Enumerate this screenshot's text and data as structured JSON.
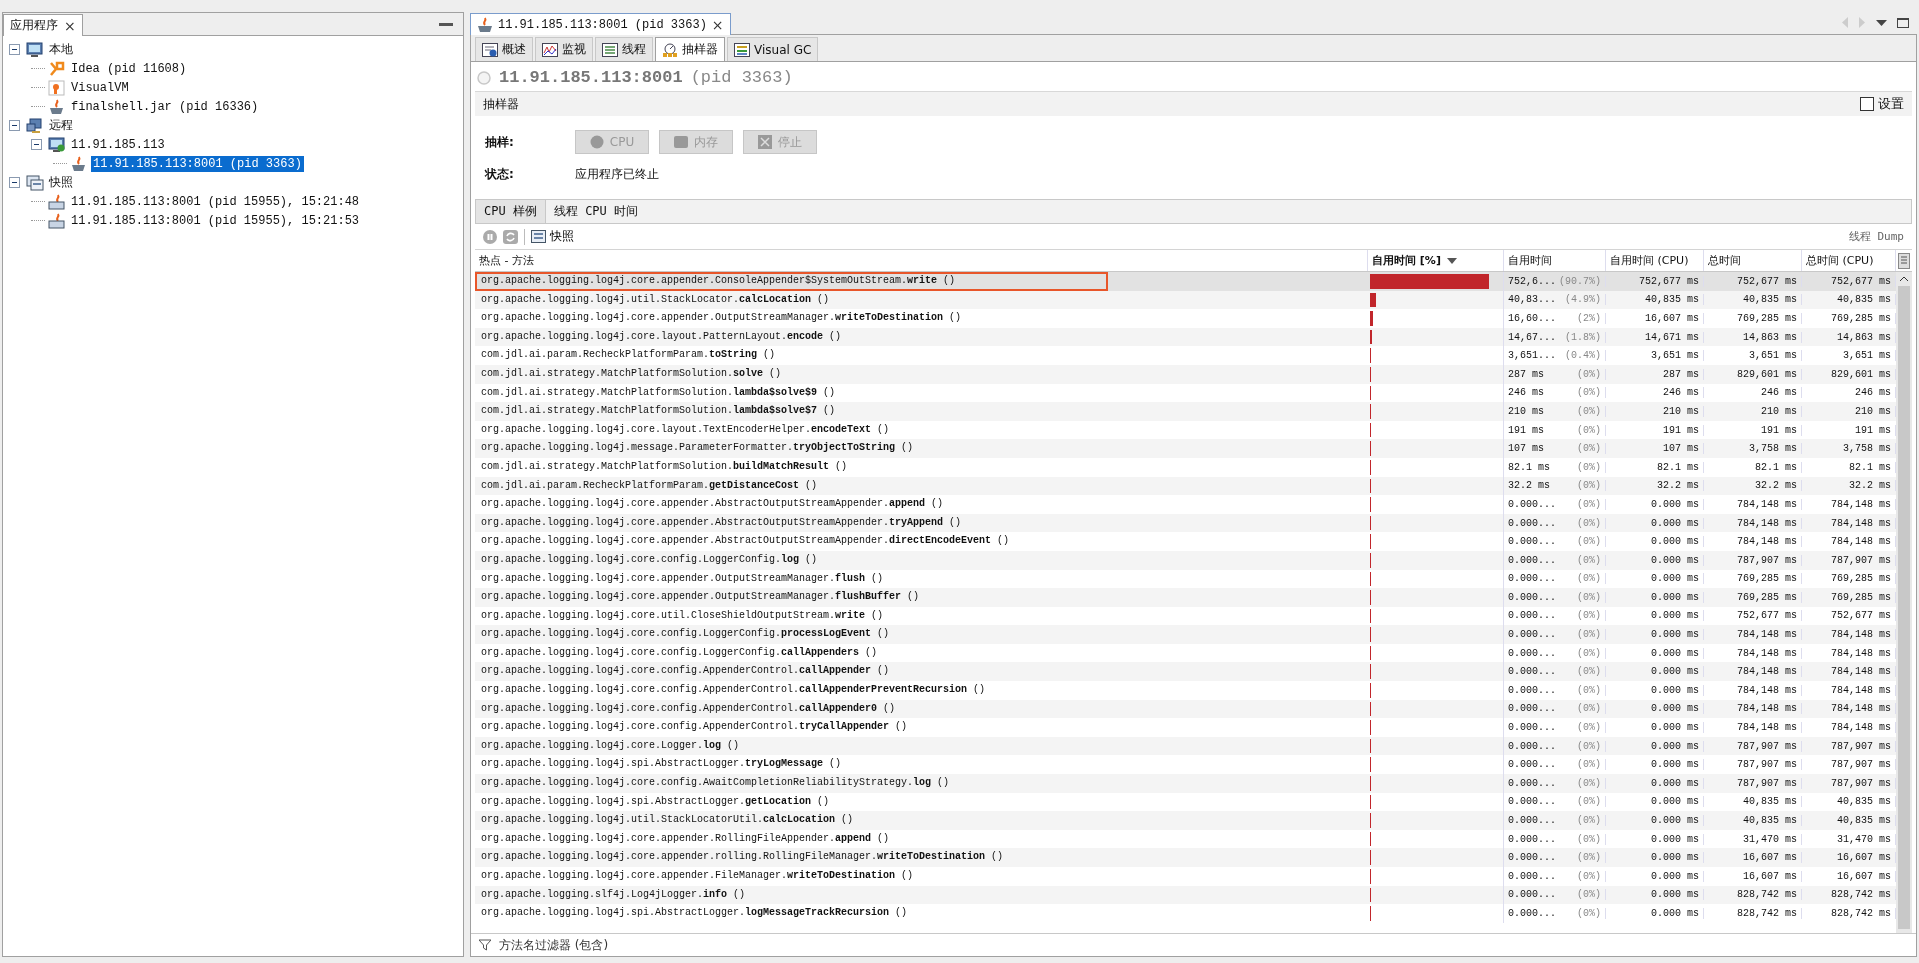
{
  "left_panel": {
    "tab": "应用程序",
    "close": "×",
    "tree": [
      {
        "label": "本地",
        "kind": "local",
        "expanded": true,
        "selected": false,
        "children": [
          {
            "label": "Idea (pid 11608)",
            "kind": "idea",
            "selected": false
          },
          {
            "label": "VisualVM",
            "kind": "visualvm",
            "selected": false
          },
          {
            "label": "finalshell.jar (pid 16336)",
            "kind": "java",
            "selected": false
          }
        ]
      },
      {
        "label": "远程",
        "kind": "remote",
        "expanded": true,
        "selected": false,
        "children": [
          {
            "label": "11.91.185.113",
            "kind": "host",
            "expanded": true,
            "selected": false,
            "children": [
              {
                "label": "11.91.185.113:8001 (pid 3363)",
                "kind": "jmx",
                "selected": true
              }
            ]
          }
        ]
      },
      {
        "label": "快照",
        "kind": "snapshots",
        "expanded": true,
        "selected": false,
        "children": [
          {
            "label": "11.91.185.113:8001 (pid 15955), 15:21:48",
            "kind": "snapshot",
            "selected": false
          },
          {
            "label": "11.91.185.113:8001 (pid 15955), 15:21:53",
            "kind": "snapshot",
            "selected": false
          }
        ]
      }
    ]
  },
  "document_tab": {
    "title": "11.91.185.113:8001 (pid 3363)",
    "close": "×"
  },
  "view_tabs": [
    {
      "label": "概述",
      "kind": "overview",
      "selected": false
    },
    {
      "label": "监视",
      "kind": "monitor",
      "selected": false
    },
    {
      "label": "线程",
      "kind": "threads",
      "selected": false
    },
    {
      "label": "抽样器",
      "kind": "sampler",
      "selected": true
    },
    {
      "label": "Visual GC",
      "kind": "gc",
      "selected": false
    }
  ],
  "header": {
    "host": "11.91.185.113:8001",
    "pid": "(pid 3363)"
  },
  "sampler": {
    "title": "抽样器",
    "settings": {
      "label": "设置",
      "checked": false
    },
    "sample_label": "抽样:",
    "buttons": [
      {
        "label": "CPU",
        "kind": "cpu",
        "disabled": true
      },
      {
        "label": "内存",
        "kind": "memory",
        "disabled": true
      },
      {
        "label": "停止",
        "kind": "stop",
        "disabled": true
      }
    ],
    "status_label": "状态:",
    "status": "应用程序已终止"
  },
  "result_tabs": [
    {
      "label": "CPU 样例",
      "selected": true
    },
    {
      "label": "线程 CPU 时间",
      "selected": false
    }
  ],
  "toolbar": {
    "snapshot": "快照",
    "thread_dump": "线程 Dump"
  },
  "columns": [
    {
      "label": "热点 - 方法",
      "sorted": false
    },
    {
      "label": "自用时间 [%]",
      "sorted": true
    },
    {
      "label": "自用时间",
      "sorted": false
    },
    {
      "label": "自用时间 (CPU)",
      "sorted": false
    },
    {
      "label": "总时间",
      "sorted": false
    },
    {
      "label": "总时间 (CPU)",
      "sorted": false
    }
  ],
  "rows": [
    {
      "method": "org.apache.logging.log4j.core.appender.ConsoleAppender$SystemOutStream.**write** ()",
      "level": 0.907,
      "self": "752,6...",
      "pct": "(90.7%)",
      "self_cpu": "752,677 ms",
      "total": "752,677 ms",
      "total_cpu": "752,677 ms",
      "selected": true
    },
    {
      "method": "org.apache.logging.log4j.util.StackLocator.**calcLocation** ()",
      "level": 0.049,
      "self": "40,83...",
      "pct": "(4.9%)",
      "self_cpu": "40,835 ms",
      "total": "40,835 ms",
      "total_cpu": "40,835 ms",
      "selected": false
    },
    {
      "method": "org.apache.logging.log4j.core.appender.OutputStreamManager.**writeToDestination** ()",
      "level": 0.02,
      "self": "16,60...",
      "pct": "(2%)",
      "self_cpu": "16,607 ms",
      "total": "769,285 ms",
      "total_cpu": "769,285 ms",
      "selected": false
    },
    {
      "method": "org.apache.logging.log4j.core.layout.PatternLayout.**encode** ()",
      "level": 0.018,
      "self": "14,67...",
      "pct": "(1.8%)",
      "self_cpu": "14,671 ms",
      "total": "14,863 ms",
      "total_cpu": "14,863 ms",
      "selected": false
    },
    {
      "method": "com.jdl.ai.param.RecheckPlatformParam.**toString** ()",
      "level": 0.004,
      "self": "3,651...",
      "pct": "(0.4%)",
      "self_cpu": "3,651 ms",
      "total": "3,651 ms",
      "total_cpu": "3,651 ms",
      "selected": false
    },
    {
      "method": "com.jdl.ai.strategy.MatchPlatformSolution.**solve** ()",
      "level": 0,
      "self": "287 ms",
      "pct": "(0%)",
      "self_cpu": "287 ms",
      "total": "829,601 ms",
      "total_cpu": "829,601 ms",
      "selected": false
    },
    {
      "method": "com.jdl.ai.strategy.MatchPlatformSolution.**lambda$solve$9** ()",
      "level": 0,
      "self": "246 ms",
      "pct": "(0%)",
      "self_cpu": "246 ms",
      "total": "246 ms",
      "total_cpu": "246 ms",
      "selected": false
    },
    {
      "method": "com.jdl.ai.strategy.MatchPlatformSolution.**lambda$solve$7** ()",
      "level": 0,
      "self": "210 ms",
      "pct": "(0%)",
      "self_cpu": "210 ms",
      "total": "210 ms",
      "total_cpu": "210 ms",
      "selected": false
    },
    {
      "method": "org.apache.logging.log4j.core.layout.TextEncoderHelper.**encodeText** ()",
      "level": 0,
      "self": "191 ms",
      "pct": "(0%)",
      "self_cpu": "191 ms",
      "total": "191 ms",
      "total_cpu": "191 ms",
      "selected": false
    },
    {
      "method": "org.apache.logging.log4j.message.ParameterFormatter.**tryObjectToString** ()",
      "level": 0,
      "self": "107 ms",
      "pct": "(0%)",
      "self_cpu": "107 ms",
      "total": "3,758 ms",
      "total_cpu": "3,758 ms",
      "selected": false
    },
    {
      "method": "com.jdl.ai.strategy.MatchPlatformSolution.**buildMatchResult** ()",
      "level": 0,
      "self": "82.1 ms",
      "pct": "(0%)",
      "self_cpu": "82.1 ms",
      "total": "82.1 ms",
      "total_cpu": "82.1 ms",
      "selected": false
    },
    {
      "method": "com.jdl.ai.param.RecheckPlatformParam.**getDistanceCost** ()",
      "level": 0,
      "self": "32.2 ms",
      "pct": "(0%)",
      "self_cpu": "32.2 ms",
      "total": "32.2 ms",
      "total_cpu": "32.2 ms",
      "selected": false
    },
    {
      "method": "org.apache.logging.log4j.core.appender.AbstractOutputStreamAppender.**append** ()",
      "level": 0,
      "self": "0.000...",
      "pct": "(0%)",
      "self_cpu": "0.000 ms",
      "total": "784,148 ms",
      "total_cpu": "784,148 ms",
      "selected": false
    },
    {
      "method": "org.apache.logging.log4j.core.appender.AbstractOutputStreamAppender.**tryAppend** ()",
      "level": 0,
      "self": "0.000...",
      "pct": "(0%)",
      "self_cpu": "0.000 ms",
      "total": "784,148 ms",
      "total_cpu": "784,148 ms",
      "selected": false
    },
    {
      "method": "org.apache.logging.log4j.core.appender.AbstractOutputStreamAppender.**directEncodeEvent** ()",
      "level": 0,
      "self": "0.000...",
      "pct": "(0%)",
      "self_cpu": "0.000 ms",
      "total": "784,148 ms",
      "total_cpu": "784,148 ms",
      "selected": false
    },
    {
      "method": "org.apache.logging.log4j.core.config.LoggerConfig.**log** ()",
      "level": 0,
      "self": "0.000...",
      "pct": "(0%)",
      "self_cpu": "0.000 ms",
      "total": "787,907 ms",
      "total_cpu": "787,907 ms",
      "selected": false
    },
    {
      "method": "org.apache.logging.log4j.core.appender.OutputStreamManager.**flush** ()",
      "level": 0,
      "self": "0.000...",
      "pct": "(0%)",
      "self_cpu": "0.000 ms",
      "total": "769,285 ms",
      "total_cpu": "769,285 ms",
      "selected": false
    },
    {
      "method": "org.apache.logging.log4j.core.appender.OutputStreamManager.**flushBuffer** ()",
      "level": 0,
      "self": "0.000...",
      "pct": "(0%)",
      "self_cpu": "0.000 ms",
      "total": "769,285 ms",
      "total_cpu": "769,285 ms",
      "selected": false
    },
    {
      "method": "org.apache.logging.log4j.core.util.CloseShieldOutputStream.**write** ()",
      "level": 0,
      "self": "0.000...",
      "pct": "(0%)",
      "self_cpu": "0.000 ms",
      "total": "752,677 ms",
      "total_cpu": "752,677 ms",
      "selected": false
    },
    {
      "method": "org.apache.logging.log4j.core.config.LoggerConfig.**processLogEvent** ()",
      "level": 0,
      "self": "0.000...",
      "pct": "(0%)",
      "self_cpu": "0.000 ms",
      "total": "784,148 ms",
      "total_cpu": "784,148 ms",
      "selected": false
    },
    {
      "method": "org.apache.logging.log4j.core.config.LoggerConfig.**callAppenders** ()",
      "level": 0,
      "self": "0.000...",
      "pct": "(0%)",
      "self_cpu": "0.000 ms",
      "total": "784,148 ms",
      "total_cpu": "784,148 ms",
      "selected": false
    },
    {
      "method": "org.apache.logging.log4j.core.config.AppenderControl.**callAppender** ()",
      "level": 0,
      "self": "0.000...",
      "pct": "(0%)",
      "self_cpu": "0.000 ms",
      "total": "784,148 ms",
      "total_cpu": "784,148 ms",
      "selected": false
    },
    {
      "method": "org.apache.logging.log4j.core.config.AppenderControl.**callAppenderPreventRecursion** ()",
      "level": 0,
      "self": "0.000...",
      "pct": "(0%)",
      "self_cpu": "0.000 ms",
      "total": "784,148 ms",
      "total_cpu": "784,148 ms",
      "selected": false
    },
    {
      "method": "org.apache.logging.log4j.core.config.AppenderControl.**callAppender0** ()",
      "level": 0,
      "self": "0.000...",
      "pct": "(0%)",
      "self_cpu": "0.000 ms",
      "total": "784,148 ms",
      "total_cpu": "784,148 ms",
      "selected": false
    },
    {
      "method": "org.apache.logging.log4j.core.config.AppenderControl.**tryCallAppender** ()",
      "level": 0,
      "self": "0.000...",
      "pct": "(0%)",
      "self_cpu": "0.000 ms",
      "total": "784,148 ms",
      "total_cpu": "784,148 ms",
      "selected": false
    },
    {
      "method": "org.apache.logging.log4j.core.Logger.**log** ()",
      "level": 0,
      "self": "0.000...",
      "pct": "(0%)",
      "self_cpu": "0.000 ms",
      "total": "787,907 ms",
      "total_cpu": "787,907 ms",
      "selected": false
    },
    {
      "method": "org.apache.logging.log4j.spi.AbstractLogger.**tryLogMessage** ()",
      "level": 0,
      "self": "0.000...",
      "pct": "(0%)",
      "self_cpu": "0.000 ms",
      "total": "787,907 ms",
      "total_cpu": "787,907 ms",
      "selected": false
    },
    {
      "method": "org.apache.logging.log4j.core.config.AwaitCompletionReliabilityStrategy.**log** ()",
      "level": 0,
      "self": "0.000...",
      "pct": "(0%)",
      "self_cpu": "0.000 ms",
      "total": "787,907 ms",
      "total_cpu": "787,907 ms",
      "selected": false
    },
    {
      "method": "org.apache.logging.log4j.spi.AbstractLogger.**getLocation** ()",
      "level": 0,
      "self": "0.000...",
      "pct": "(0%)",
      "self_cpu": "0.000 ms",
      "total": "40,835 ms",
      "total_cpu": "40,835 ms",
      "selected": false
    },
    {
      "method": "org.apache.logging.log4j.util.StackLocatorUtil.**calcLocation** ()",
      "level": 0,
      "self": "0.000...",
      "pct": "(0%)",
      "self_cpu": "0.000 ms",
      "total": "40,835 ms",
      "total_cpu": "40,835 ms",
      "selected": false
    },
    {
      "method": "org.apache.logging.log4j.core.appender.RollingFileAppender.**append** ()",
      "level": 0,
      "self": "0.000...",
      "pct": "(0%)",
      "self_cpu": "0.000 ms",
      "total": "31,470 ms",
      "total_cpu": "31,470 ms",
      "selected": false
    },
    {
      "method": "org.apache.logging.log4j.core.appender.rolling.RollingFileManager.**writeToDestination** ()",
      "level": 0,
      "self": "0.000...",
      "pct": "(0%)",
      "self_cpu": "0.000 ms",
      "total": "16,607 ms",
      "total_cpu": "16,607 ms",
      "selected": false
    },
    {
      "method": "org.apache.logging.log4j.core.appender.FileManager.**writeToDestination** ()",
      "level": 0,
      "self": "0.000...",
      "pct": "(0%)",
      "self_cpu": "0.000 ms",
      "total": "16,607 ms",
      "total_cpu": "16,607 ms",
      "selected": false
    },
    {
      "method": "org.apache.logging.slf4j.Log4jLogger.**info** ()",
      "level": 0,
      "self": "0.000...",
      "pct": "(0%)",
      "self_cpu": "0.000 ms",
      "total": "828,742 ms",
      "total_cpu": "828,742 ms",
      "selected": false
    },
    {
      "method": "org.apache.logging.log4j.spi.AbstractLogger.**logMessageTrackRecursion** ()",
      "level": 0,
      "self": "0.000...",
      "pct": "(0%)",
      "self_cpu": "0.000 ms",
      "total": "828,742 ms",
      "total_cpu": "828,742 ms",
      "selected": false
    }
  ],
  "filter": {
    "placeholder": "方法名过滤器 (包含)"
  }
}
